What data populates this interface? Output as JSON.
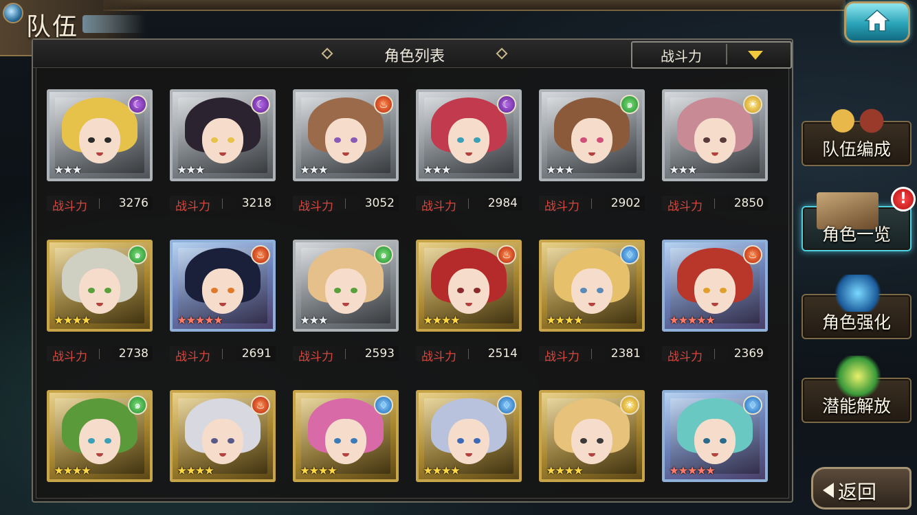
{
  "header": {
    "title": "队伍"
  },
  "panel": {
    "title": "角色列表",
    "sort_label": "战斗力"
  },
  "power_label": "战斗力",
  "characters": [
    {
      "power": "3276",
      "element": "dark",
      "element_symbol": "☾",
      "rarity": "silver",
      "stars": 3,
      "hair": "#e6c24a",
      "eyes": "#2a2a2a"
    },
    {
      "power": "3218",
      "element": "dark",
      "element_symbol": "☾",
      "rarity": "silver",
      "stars": 3,
      "hair": "#2b2430",
      "eyes": "#e8c34a"
    },
    {
      "power": "3052",
      "element": "fire",
      "element_symbol": "♨",
      "rarity": "silver",
      "stars": 3,
      "hair": "#9a6a4a",
      "eyes": "#8a5ab8"
    },
    {
      "power": "2984",
      "element": "dark",
      "element_symbol": "☾",
      "rarity": "silver",
      "stars": 3,
      "hair": "#c23a4e",
      "eyes": "#3aa0b8"
    },
    {
      "power": "2902",
      "element": "wind",
      "element_symbol": "๑",
      "rarity": "silver",
      "stars": 3,
      "hair": "#8a5a3a",
      "eyes": "#d0507a"
    },
    {
      "power": "2850",
      "element": "light",
      "element_symbol": "☀",
      "rarity": "silver",
      "stars": 3,
      "hair": "#c88a94",
      "eyes": "#5a3a3a"
    },
    {
      "power": "2738",
      "element": "wind",
      "element_symbol": "๑",
      "rarity": "gold",
      "stars": 4,
      "hair": "#cfcfc2",
      "eyes": "#5aa03a"
    },
    {
      "power": "2691",
      "element": "fire",
      "element_symbol": "♨",
      "rarity": "rainbow",
      "stars": 5,
      "hair": "#1a1f3a",
      "eyes": "#e07a2a"
    },
    {
      "power": "2593",
      "element": "wind",
      "element_symbol": "๑",
      "rarity": "silver",
      "stars": 3,
      "hair": "#e6c08a",
      "eyes": "#5aa03a"
    },
    {
      "power": "2514",
      "element": "fire",
      "element_symbol": "♨",
      "rarity": "gold",
      "stars": 4,
      "hair": "#b52a2a",
      "eyes": "#8a2a2a"
    },
    {
      "power": "2381",
      "element": "water",
      "element_symbol": "♢",
      "rarity": "gold",
      "stars": 4,
      "hair": "#e6c06a",
      "eyes": "#5a8ab8"
    },
    {
      "power": "2369",
      "element": "fire",
      "element_symbol": "♨",
      "rarity": "rainbow",
      "stars": 5,
      "hair": "#b8362a",
      "eyes": "#e0a02a"
    },
    {
      "power": "",
      "element": "wind",
      "element_symbol": "๑",
      "rarity": "gold",
      "stars": 4,
      "hair": "#5a9a3a",
      "eyes": "#3aa0b8"
    },
    {
      "power": "",
      "element": "fire",
      "element_symbol": "♨",
      "rarity": "gold",
      "stars": 4,
      "hair": "#d8d8e0",
      "eyes": "#5a5a8a"
    },
    {
      "power": "",
      "element": "water",
      "element_symbol": "♢",
      "rarity": "gold",
      "stars": 4,
      "hair": "#d86aa8",
      "eyes": "#3a7ab8"
    },
    {
      "power": "",
      "element": "water",
      "element_symbol": "♢",
      "rarity": "gold",
      "stars": 4,
      "hair": "#b8c2dc",
      "eyes": "#3a6ab8"
    },
    {
      "power": "",
      "element": "light",
      "element_symbol": "☀",
      "rarity": "gold",
      "stars": 4,
      "hair": "#e6c27a",
      "eyes": "#3a3a3a"
    },
    {
      "power": "",
      "element": "water",
      "element_symbol": "♢",
      "rarity": "rainbow",
      "stars": 5,
      "hair": "#6ac8c2",
      "eyes": "#2a6a8a"
    }
  ],
  "side_menu": [
    {
      "id": "team-edit",
      "label": "队伍编成",
      "active": false,
      "alert": false
    },
    {
      "id": "char-list",
      "label": "角色一览",
      "active": true,
      "alert": true,
      "alert_symbol": "!"
    },
    {
      "id": "char-enhance",
      "label": "角色强化",
      "active": false,
      "alert": false
    },
    {
      "id": "potential",
      "label": "潜能解放",
      "active": false,
      "alert": false
    }
  ],
  "back_label": "返回",
  "colors": {
    "accent": "#4fd0e0",
    "power_label": "#d9473f",
    "sort_arrow": "#f0c93c"
  }
}
